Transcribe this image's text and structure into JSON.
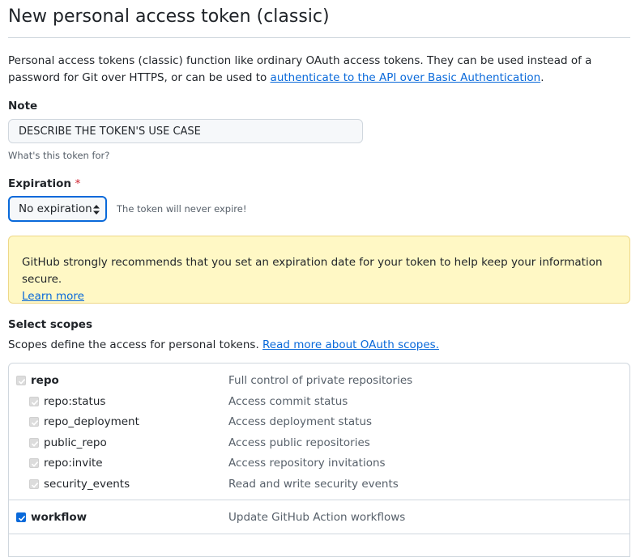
{
  "header": {
    "title": "New personal access token (classic)"
  },
  "intro": {
    "text_before_link": "Personal access tokens (classic) function like ordinary OAuth access tokens. They can be used instead of a password for Git over HTTPS, or can be used to ",
    "link_text": "authenticate to the API over Basic Authentication",
    "text_after_link": "."
  },
  "note": {
    "label": "Note",
    "value": "DESCRIBE THE TOKEN'S USE CASE",
    "hint": "What's this token for?"
  },
  "expiration": {
    "label": "Expiration",
    "required_mark": "*",
    "selected": "No expiration",
    "hint": "The token will never expire!"
  },
  "flash": {
    "message": "GitHub strongly recommends that you set an expiration date for your token to help keep your information secure.",
    "link_text": "Learn more"
  },
  "scopes": {
    "heading": "Select scopes",
    "description": "Scopes define the access for personal tokens.",
    "link_text": "Read more about OAuth scopes.",
    "groups": [
      {
        "name": "repo",
        "description": "Full control of private repositories",
        "checked": true,
        "disabled": true,
        "children": [
          {
            "name": "repo:status",
            "description": "Access commit status"
          },
          {
            "name": "repo_deployment",
            "description": "Access deployment status"
          },
          {
            "name": "public_repo",
            "description": "Access public repositories"
          },
          {
            "name": "repo:invite",
            "description": "Access repository invitations"
          },
          {
            "name": "security_events",
            "description": "Read and write security events"
          }
        ]
      },
      {
        "name": "workflow",
        "description": "Update GitHub Action workflows",
        "checked": true,
        "disabled": false,
        "children": []
      }
    ]
  },
  "colors": {
    "link": "#0969da",
    "warning_bg": "#fff8c5",
    "required": "#cf222e",
    "border": "#d0d7de"
  }
}
